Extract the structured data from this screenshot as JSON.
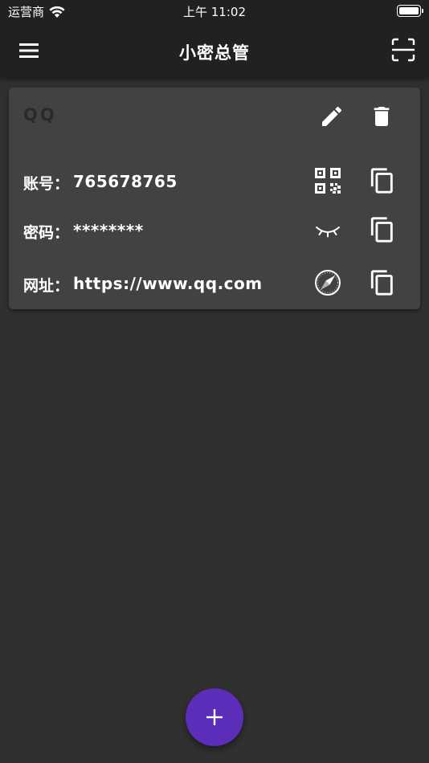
{
  "status_bar": {
    "carrier": "运营商",
    "time": "上午 11:02",
    "battery_level": 1.0
  },
  "app_bar": {
    "title": "小密总管",
    "menu_icon": "menu-icon",
    "scan_icon": "scan-icon"
  },
  "card": {
    "title": "QQ",
    "edit_icon": "pencil-icon",
    "delete_icon": "trash-icon",
    "rows": [
      {
        "label": "账号：",
        "value": "765678765",
        "action_icon": "qr-code-icon",
        "copy_icon": "copy-icon"
      },
      {
        "label": "密码：",
        "value": "********",
        "action_icon": "eye-closed-icon",
        "copy_icon": "copy-icon"
      },
      {
        "label": "网址：",
        "value": "https://www.qq.com",
        "action_icon": "compass-icon",
        "copy_icon": "copy-icon"
      }
    ]
  },
  "fab": {
    "icon": "plus-icon",
    "color": "#5b2db8"
  },
  "colors": {
    "background": "#303030",
    "app_bar": "#212121",
    "card": "#424242",
    "accent": "#5b2db8"
  }
}
